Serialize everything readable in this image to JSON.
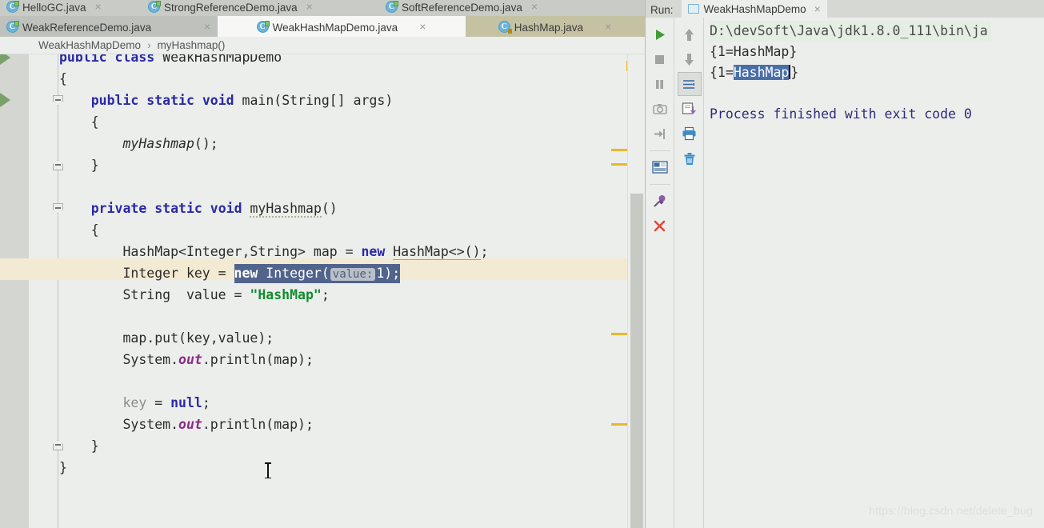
{
  "editor": {
    "tab_rows": [
      [
        {
          "label": "HelloGC.java",
          "state": "inactive",
          "icon": "java-class-icon",
          "close": "×"
        },
        {
          "label": "StrongReferenceDemo.java",
          "state": "inactive",
          "icon": "java-class-icon",
          "close": "×"
        },
        {
          "label": "SoftReferenceDemo.java",
          "state": "inactive",
          "icon": "java-class-icon",
          "close": "×"
        }
      ],
      [
        {
          "label": "WeakReferenceDemo.java",
          "state": "inactive",
          "icon": "java-class-icon",
          "close": "×"
        },
        {
          "label": "WeakHashMapDemo.java",
          "state": "active",
          "icon": "java-class-icon",
          "close": "×"
        },
        {
          "label": "HashMap.java",
          "state": "library",
          "icon": "java-class-locked-icon",
          "close": "×"
        }
      ]
    ],
    "breadcrumb": {
      "class": "WeakHashMapDemo",
      "separator": "›",
      "method": "myHashmap()"
    },
    "code_lines": [
      {
        "text": "public class WeakHashMapDemo"
      },
      {
        "text": "{"
      },
      {
        "text": "    public static void main(String[] args)"
      },
      {
        "text": "    {"
      },
      {
        "text": "        myHashmap();"
      },
      {
        "text": "    }"
      },
      {
        "text": ""
      },
      {
        "text": "    private static void myHashmap()"
      },
      {
        "text": "    {"
      },
      {
        "text": "        HashMap<Integer,String> map = new HashMap<>();"
      },
      {
        "text": "        Integer key = new Integer( value: 1);"
      },
      {
        "text": "        String  value = \"HashMap\";"
      },
      {
        "text": ""
      },
      {
        "text": "        map.put(key,value);"
      },
      {
        "text": "        System.out.println(map);"
      },
      {
        "text": ""
      },
      {
        "text": "        key = null;"
      },
      {
        "text": "        System.out.println(map);"
      },
      {
        "text": "    }"
      },
      {
        "text": "}"
      }
    ],
    "tokens": {
      "kw_public": "public",
      "kw_class": "class",
      "kw_static": "static",
      "kw_void": "void",
      "kw_private": "private",
      "kw_new": "new",
      "kw_null": "null",
      "type_name": "WeakHashMapDemo",
      "main": "main",
      "args": "(String[] args)",
      "call_myhashmap": "myHashmap();",
      "method_myhashmap": "myHashmap()",
      "hashmap_decl": "HashMap<Integer,String> map = ",
      "hashmap_new": "HashMap<>();",
      "integer_decl": "Integer key = ",
      "integer_new": "new Integer(",
      "hint_value": "value:",
      "int_one": "1);",
      "string_decl": "String  value = ",
      "string_lit": "\"HashMap\"",
      "semi": ";",
      "map_put": "map.put(key,value);",
      "sys": "System.",
      "out": "out",
      "println": ".println(map);",
      "key_null_a": "key",
      "key_null_b": " = ",
      "key_null_c": "null",
      "brace_open": "{",
      "brace_close": "}"
    },
    "selection_text": "new Integer( value: 1);",
    "gutter": {
      "fold_open_icon": "fold-collapse-icon",
      "fold_close_icon": "fold-expand-icon",
      "run_gutter_icon": "run-gutter-arrow-icon",
      "intention_icon": "lightbulb-intention-icon"
    }
  },
  "run_panel": {
    "label": "Run:",
    "tab_name": "WeakHashMapDemo",
    "tab_close": "×",
    "toolbar_left": [
      {
        "name": "rerun-button",
        "icon": "play-icon",
        "tooltip": "Rerun"
      },
      {
        "name": "stop-button",
        "icon": "stop-square-icon",
        "tooltip": "Stop"
      },
      {
        "name": "pause-button",
        "icon": "pause-bars-icon",
        "tooltip": "Pause Output"
      },
      {
        "name": "screenshot-button",
        "icon": "camera-icon",
        "tooltip": "Dump Threads"
      },
      {
        "name": "attach-button",
        "icon": "arrow-into-box-icon",
        "tooltip": "Attach"
      },
      {
        "name": "layout-button",
        "icon": "restore-layout-icon",
        "tooltip": "Restore Layout"
      },
      {
        "name": "pin-button",
        "icon": "pin-icon",
        "tooltip": "Pin Tab"
      },
      {
        "name": "close-button",
        "icon": "close-x-icon",
        "tooltip": "Close"
      }
    ],
    "toolbar_right": [
      {
        "name": "up-button",
        "icon": "arrow-up-icon",
        "tooltip": "Up the Stack Trace"
      },
      {
        "name": "down-button",
        "icon": "arrow-down-icon",
        "tooltip": "Down the Stack Trace"
      },
      {
        "name": "soft-wrap-button",
        "icon": "soft-wrap-icon",
        "tooltip": "Use Soft Wraps",
        "pressed": true
      },
      {
        "name": "export-button",
        "icon": "export-to-file-icon",
        "tooltip": "Export to Text File"
      },
      {
        "name": "print-button",
        "icon": "printer-icon",
        "tooltip": "Print"
      },
      {
        "name": "clear-all-button",
        "icon": "trash-icon",
        "tooltip": "Clear All"
      }
    ],
    "console_lines": [
      {
        "text": "D:\\devSoft\\Java\\jdk1.8.0_111\\bin\\ja",
        "style": "command"
      },
      {
        "text": "{1=HashMap}",
        "style": "output"
      },
      {
        "text": "{1=HashMap}",
        "style": "output-selected"
      },
      {
        "text": "",
        "style": "output"
      },
      {
        "text": "Process finished with exit code 0",
        "style": "exit"
      }
    ],
    "console_selected_word": "HashMap",
    "console_line3_prefix": "{1=",
    "console_line3_suffix": "}"
  },
  "watermark": "https://blog.csdn.net/delete_bug"
}
